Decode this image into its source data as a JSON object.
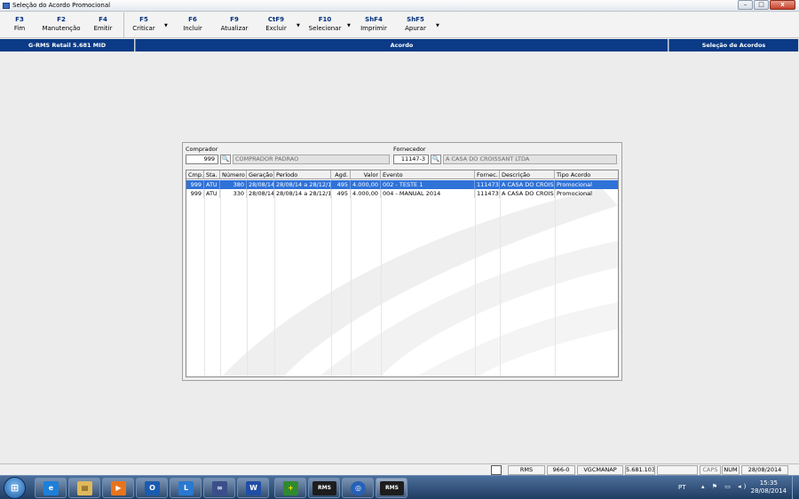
{
  "window": {
    "title": "Seleção do Acordo Promocional",
    "controls": {
      "minimize": "–",
      "maximize": "□",
      "close": "x"
    }
  },
  "toolbar": {
    "buttons": [
      {
        "key": "F3",
        "label": "Fim"
      },
      {
        "key": "F2",
        "label": "Manutenção"
      },
      {
        "key": "F4",
        "label": "Emitir"
      },
      {
        "key": "F5",
        "label": "Criticar"
      },
      {
        "key": "F6",
        "label": "Incluir"
      },
      {
        "key": "F9",
        "label": "Atualizar"
      },
      {
        "key": "CtF9",
        "label": "Excluir"
      },
      {
        "key": "F10",
        "label": "Selecionar"
      },
      {
        "key": "ShF4",
        "label": "Imprimir"
      },
      {
        "key": "ShF5",
        "label": "Apurar"
      }
    ]
  },
  "header": {
    "version": "G-RMS Retail 5.681 MID",
    "module": "Acordo",
    "screen": "Seleção de Acordos"
  },
  "filters": {
    "comprador_label": "Comprador",
    "comprador_code": "999",
    "comprador_name": "COMPRADOR PADRAO",
    "fornecedor_label": "Fornecedor",
    "fornecedor_code": "11147-3",
    "fornecedor_name": "A CASA DO CROISSANT LTDA"
  },
  "grid": {
    "columns": [
      "Cmp.",
      "Sta.",
      "Número",
      "Geração",
      "Período",
      "Agd.",
      "Valor",
      "Evento",
      "Fornec.",
      "Descrição",
      "Tipo Acordo"
    ],
    "rows": [
      {
        "cmp": "999",
        "sta": "ATU",
        "numero": "380",
        "geracao": "28/08/14",
        "periodo": "28/08/14 a 28/12/14",
        "agd": "495",
        "valor": "4.000,00",
        "evento": "002 -  TESTE 1",
        "fornec": "111473",
        "descricao": "A CASA DO CROISS",
        "tipo": "Promocional",
        "selected": true
      },
      {
        "cmp": "999",
        "sta": "ATU",
        "numero": "330",
        "geracao": "28/08/14",
        "periodo": "28/08/14 a 28/12/14",
        "agd": "495",
        "valor": "4.000,00",
        "evento": "004 -  MANUAL 2014",
        "fornec": "111473",
        "descricao": "A CASA DO CROISS",
        "tipo": "Promocional",
        "selected": false
      }
    ]
  },
  "statusbar": {
    "system": "RMS",
    "code": "966-0",
    "user": "VGCMANAP",
    "version": "5.681.1030",
    "caps": "CAPS",
    "num": "NUM",
    "date": "28/08/2014"
  },
  "taskbar": {
    "start_label": "⊞",
    "apps": [
      "e",
      "▤",
      "▶",
      "O",
      "L",
      "∞",
      "W",
      "+",
      "RMS",
      "◎",
      "RMS"
    ],
    "lang": "PT",
    "tray_icons": "▴ ⚑ ▭ ◂)",
    "time": "15:35",
    "date": "28/08/2014"
  },
  "colors": {
    "header_blue": "#0b3a86",
    "selected_row": "#2f72d8",
    "taskbar_top": "#4c6f9b"
  }
}
